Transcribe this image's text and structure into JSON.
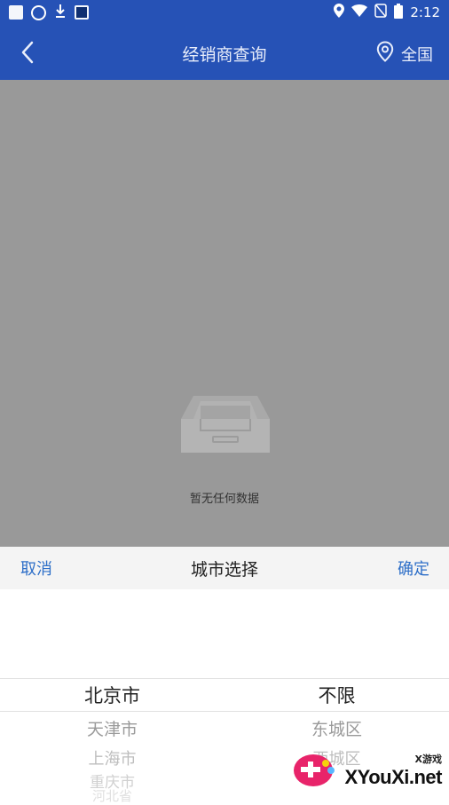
{
  "status_bar": {
    "time": "2:12",
    "left_icons": [
      "image-icon",
      "emoji-icon",
      "download-icon",
      "app-icon"
    ],
    "right_icons": [
      "location-icon",
      "wifi-icon",
      "signal-off-icon",
      "battery-icon"
    ]
  },
  "nav": {
    "title": "经销商查询",
    "location_label": "全国"
  },
  "empty_state": {
    "message": "暂无任何数据"
  },
  "picker": {
    "cancel_label": "取消",
    "title": "城市选择",
    "confirm_label": "确定",
    "provinces": [
      "北京市",
      "天津市",
      "上海市",
      "重庆市",
      "河北省"
    ],
    "districts": [
      "不限",
      "东城区",
      "西城区"
    ]
  },
  "watermark": {
    "small": "X游戏",
    "big": "XYouXi.net"
  },
  "colors": {
    "header_blue": "#2652b6",
    "action_blue": "#2e6fc8",
    "overlay_gray": "#999999"
  }
}
